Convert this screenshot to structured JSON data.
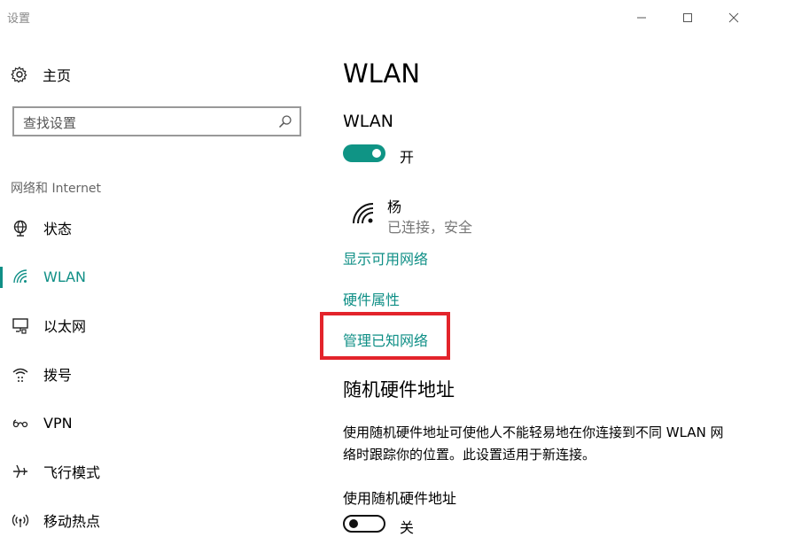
{
  "window": {
    "title": "设置",
    "buttons": {
      "minimize": "minimize-icon",
      "maximize": "maximize-icon",
      "close": "close-icon"
    }
  },
  "sidebar": {
    "home_label": "主页",
    "search_placeholder": "查找设置",
    "section_heading": "网络和 Internet",
    "items": [
      {
        "label": "状态",
        "icon": "globe-icon",
        "active": false
      },
      {
        "label": "WLAN",
        "icon": "wifi-icon",
        "active": true
      },
      {
        "label": "以太网",
        "icon": "ethernet-icon",
        "active": false
      },
      {
        "label": "拨号",
        "icon": "dialup-icon",
        "active": false
      },
      {
        "label": "VPN",
        "icon": "vpn-icon",
        "active": false
      },
      {
        "label": "飞行模式",
        "icon": "airplane-icon",
        "active": false
      },
      {
        "label": "移动热点",
        "icon": "hotspot-icon",
        "active": false
      }
    ]
  },
  "main": {
    "title": "WLAN",
    "wlan_label": "WLAN",
    "wlan_toggle_state": "开",
    "wlan_on": true,
    "network": {
      "name": "杨",
      "status": "已连接，安全"
    },
    "links": {
      "show_available": "显示可用网络",
      "hardware_props": "硬件属性",
      "manage_known": "管理已知网络"
    },
    "random_hw": {
      "title": "随机硬件地址",
      "description": "使用随机硬件地址可使他人不能轻易地在你连接到不同 WLAN 网络时跟踪你的位置。此设置适用于新连接。",
      "option_label": "使用随机硬件地址",
      "toggle_state": "关",
      "on": false
    }
  },
  "colors": {
    "accent": "#0f8f86",
    "highlight": "#e3242b"
  }
}
